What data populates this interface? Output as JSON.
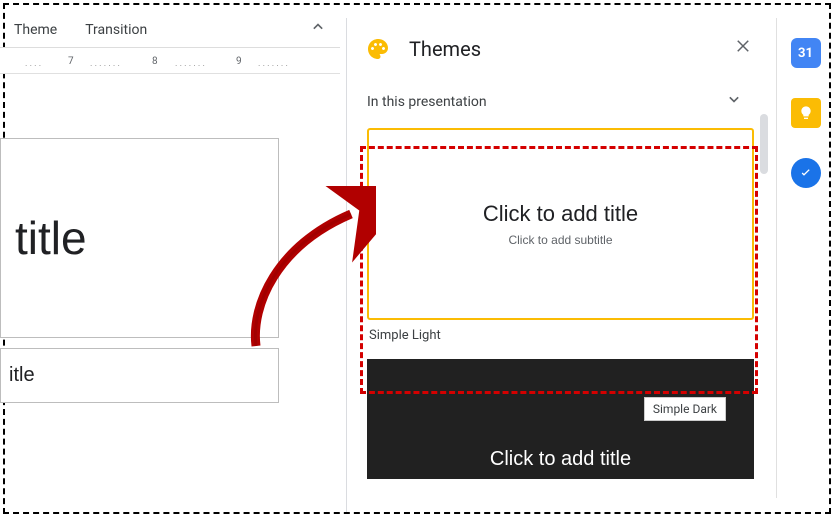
{
  "menubar": {
    "theme_label": "Theme",
    "transition_label": "Transition"
  },
  "ruler": {
    "marks": [
      "7",
      "8",
      "9"
    ]
  },
  "canvas": {
    "title_placeholder_fragment": "title",
    "subtitle_placeholder_fragment": "itle"
  },
  "themes_panel": {
    "title": "Themes",
    "section_label": "In this presentation",
    "themes": [
      {
        "name": "Simple Light",
        "preview_title": "Click to add title",
        "preview_subtitle": "Click to add subtitle",
        "selected": true
      },
      {
        "name": "Simple Dark",
        "preview_title": "Click to add title",
        "tooltip": "Simple Dark"
      }
    ]
  },
  "side_rail": {
    "calendar_day": "31"
  }
}
